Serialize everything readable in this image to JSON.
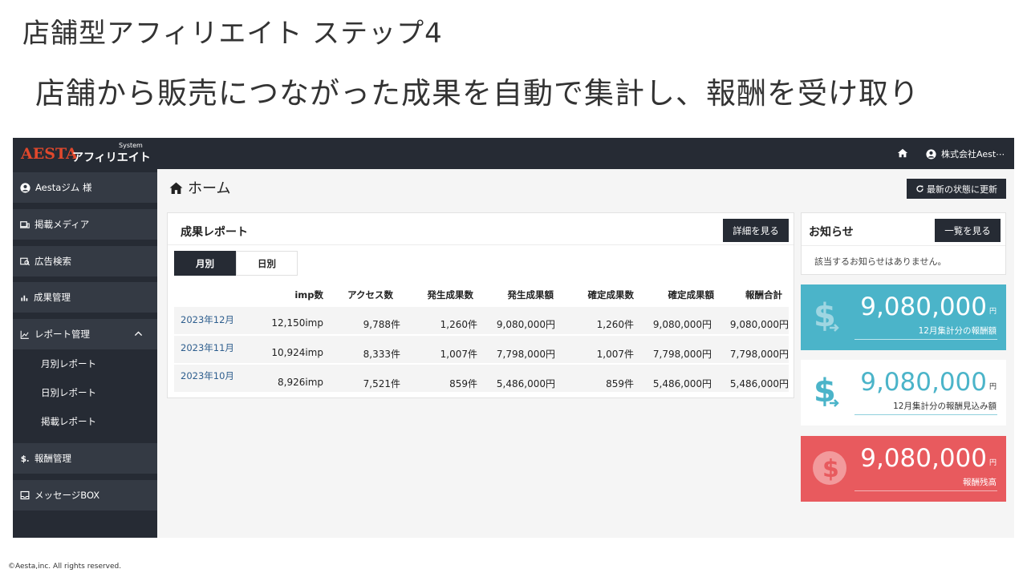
{
  "slide": {
    "title": "店舗型アフィリエイト ステップ4",
    "subtitle": "店舗から販売につながった成果を自動で集計し、報酬を受け取り",
    "footer": "©Aesta,inc. All rights reserved."
  },
  "header": {
    "logo_main": "AESTA",
    "logo_sub": "アフィリエイト",
    "logo_system": "System",
    "user_name": "株式会社Aest⋯"
  },
  "sidebar": {
    "account": "Aestaジム 様",
    "items": [
      {
        "label": "掲載メディア",
        "icon": "media-icon"
      },
      {
        "label": "広告検索",
        "icon": "ad-search-icon"
      },
      {
        "label": "成果管理",
        "icon": "bar-chart-icon"
      },
      {
        "label": "レポート管理",
        "icon": "line-chart-icon"
      },
      {
        "label": "報酬管理",
        "icon": "dollar-icon"
      },
      {
        "label": "メッセージBOX",
        "icon": "inbox-icon"
      }
    ],
    "sub_items": [
      "月別レポート",
      "日別レポート",
      "掲載レポート"
    ]
  },
  "main": {
    "breadcrumb": "ホーム",
    "refresh_label": "最新の状態に更新"
  },
  "report": {
    "title": "成果レポート",
    "detail_label": "詳細を見る",
    "tabs": [
      "月別",
      "日別"
    ],
    "active_tab": "月別",
    "columns": [
      "imp数",
      "アクセス数",
      "発生成果数",
      "発生成果額",
      "確定成果数",
      "確定成果額",
      "報酬合計"
    ],
    "rows": [
      {
        "month": "2023年12月",
        "cells": [
          "12,150imp",
          "9,788件",
          "1,260件",
          "9,080,000円",
          "1,260件",
          "9,080,000円",
          "9,080,000円"
        ]
      },
      {
        "month": "2023年11月",
        "cells": [
          "10,924imp",
          "8,333件",
          "1,007件",
          "7,798,000円",
          "1,007件",
          "7,798,000円",
          "7,798,000円"
        ]
      },
      {
        "month": "2023年10月",
        "cells": [
          "8,926imp",
          "7,521件",
          "859件",
          "5,486,000円",
          "859件",
          "5,486,000円",
          "5,486,000円"
        ]
      }
    ]
  },
  "notice": {
    "title": "お知らせ",
    "list_label": "一覧を見る",
    "empty_message": "該当するお知らせはありません。"
  },
  "stats": [
    {
      "amount": "9,080,000",
      "unit": "円",
      "label": "12月集計分の報酬額",
      "color": "#4bb4c9",
      "icon": "dollar-transfer-icon"
    },
    {
      "amount": "9,080,000",
      "unit": "円",
      "label": "12月集計分の報酬見込み額",
      "color": "#ffffff",
      "icon": "dollar-transfer-icon"
    },
    {
      "amount": "9,080,000",
      "unit": "円",
      "label": "報酬残高",
      "color": "#e85a5e",
      "icon": "dollar-coin-icon"
    }
  ],
  "colors": {
    "dark": "#262b34",
    "accent": "#4bb4c9",
    "danger": "#e85a5e",
    "logo": "#e0482c"
  }
}
